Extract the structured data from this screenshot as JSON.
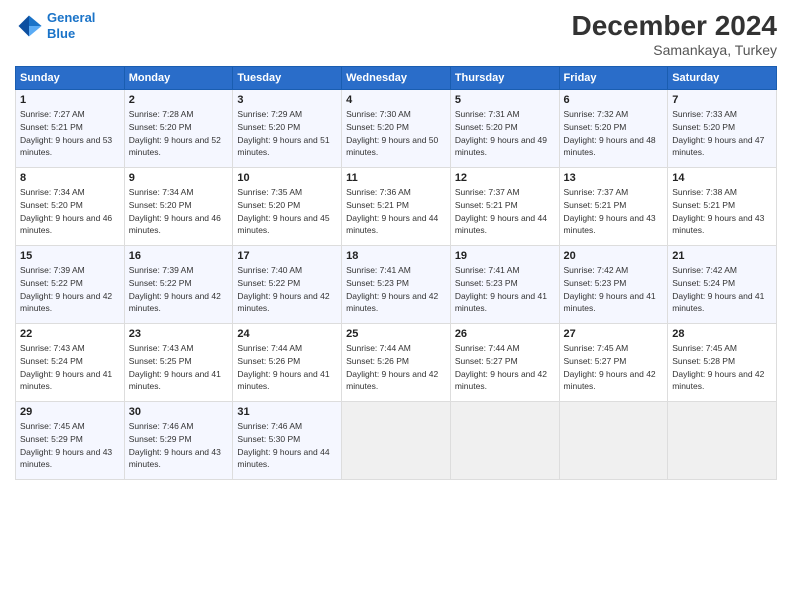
{
  "logo": {
    "line1": "General",
    "line2": "Blue"
  },
  "title": "December 2024",
  "subtitle": "Samankaya, Turkey",
  "days_of_week": [
    "Sunday",
    "Monday",
    "Tuesday",
    "Wednesday",
    "Thursday",
    "Friday",
    "Saturday"
  ],
  "weeks": [
    [
      {
        "day": "1",
        "sunrise": "Sunrise: 7:27 AM",
        "sunset": "Sunset: 5:21 PM",
        "daylight": "Daylight: 9 hours and 53 minutes."
      },
      {
        "day": "2",
        "sunrise": "Sunrise: 7:28 AM",
        "sunset": "Sunset: 5:20 PM",
        "daylight": "Daylight: 9 hours and 52 minutes."
      },
      {
        "day": "3",
        "sunrise": "Sunrise: 7:29 AM",
        "sunset": "Sunset: 5:20 PM",
        "daylight": "Daylight: 9 hours and 51 minutes."
      },
      {
        "day": "4",
        "sunrise": "Sunrise: 7:30 AM",
        "sunset": "Sunset: 5:20 PM",
        "daylight": "Daylight: 9 hours and 50 minutes."
      },
      {
        "day": "5",
        "sunrise": "Sunrise: 7:31 AM",
        "sunset": "Sunset: 5:20 PM",
        "daylight": "Daylight: 9 hours and 49 minutes."
      },
      {
        "day": "6",
        "sunrise": "Sunrise: 7:32 AM",
        "sunset": "Sunset: 5:20 PM",
        "daylight": "Daylight: 9 hours and 48 minutes."
      },
      {
        "day": "7",
        "sunrise": "Sunrise: 7:33 AM",
        "sunset": "Sunset: 5:20 PM",
        "daylight": "Daylight: 9 hours and 47 minutes."
      }
    ],
    [
      {
        "day": "8",
        "sunrise": "Sunrise: 7:34 AM",
        "sunset": "Sunset: 5:20 PM",
        "daylight": "Daylight: 9 hours and 46 minutes."
      },
      {
        "day": "9",
        "sunrise": "Sunrise: 7:34 AM",
        "sunset": "Sunset: 5:20 PM",
        "daylight": "Daylight: 9 hours and 46 minutes."
      },
      {
        "day": "10",
        "sunrise": "Sunrise: 7:35 AM",
        "sunset": "Sunset: 5:20 PM",
        "daylight": "Daylight: 9 hours and 45 minutes."
      },
      {
        "day": "11",
        "sunrise": "Sunrise: 7:36 AM",
        "sunset": "Sunset: 5:21 PM",
        "daylight": "Daylight: 9 hours and 44 minutes."
      },
      {
        "day": "12",
        "sunrise": "Sunrise: 7:37 AM",
        "sunset": "Sunset: 5:21 PM",
        "daylight": "Daylight: 9 hours and 44 minutes."
      },
      {
        "day": "13",
        "sunrise": "Sunrise: 7:37 AM",
        "sunset": "Sunset: 5:21 PM",
        "daylight": "Daylight: 9 hours and 43 minutes."
      },
      {
        "day": "14",
        "sunrise": "Sunrise: 7:38 AM",
        "sunset": "Sunset: 5:21 PM",
        "daylight": "Daylight: 9 hours and 43 minutes."
      }
    ],
    [
      {
        "day": "15",
        "sunrise": "Sunrise: 7:39 AM",
        "sunset": "Sunset: 5:22 PM",
        "daylight": "Daylight: 9 hours and 42 minutes."
      },
      {
        "day": "16",
        "sunrise": "Sunrise: 7:39 AM",
        "sunset": "Sunset: 5:22 PM",
        "daylight": "Daylight: 9 hours and 42 minutes."
      },
      {
        "day": "17",
        "sunrise": "Sunrise: 7:40 AM",
        "sunset": "Sunset: 5:22 PM",
        "daylight": "Daylight: 9 hours and 42 minutes."
      },
      {
        "day": "18",
        "sunrise": "Sunrise: 7:41 AM",
        "sunset": "Sunset: 5:23 PM",
        "daylight": "Daylight: 9 hours and 42 minutes."
      },
      {
        "day": "19",
        "sunrise": "Sunrise: 7:41 AM",
        "sunset": "Sunset: 5:23 PM",
        "daylight": "Daylight: 9 hours and 41 minutes."
      },
      {
        "day": "20",
        "sunrise": "Sunrise: 7:42 AM",
        "sunset": "Sunset: 5:23 PM",
        "daylight": "Daylight: 9 hours and 41 minutes."
      },
      {
        "day": "21",
        "sunrise": "Sunrise: 7:42 AM",
        "sunset": "Sunset: 5:24 PM",
        "daylight": "Daylight: 9 hours and 41 minutes."
      }
    ],
    [
      {
        "day": "22",
        "sunrise": "Sunrise: 7:43 AM",
        "sunset": "Sunset: 5:24 PM",
        "daylight": "Daylight: 9 hours and 41 minutes."
      },
      {
        "day": "23",
        "sunrise": "Sunrise: 7:43 AM",
        "sunset": "Sunset: 5:25 PM",
        "daylight": "Daylight: 9 hours and 41 minutes."
      },
      {
        "day": "24",
        "sunrise": "Sunrise: 7:44 AM",
        "sunset": "Sunset: 5:26 PM",
        "daylight": "Daylight: 9 hours and 41 minutes."
      },
      {
        "day": "25",
        "sunrise": "Sunrise: 7:44 AM",
        "sunset": "Sunset: 5:26 PM",
        "daylight": "Daylight: 9 hours and 42 minutes."
      },
      {
        "day": "26",
        "sunrise": "Sunrise: 7:44 AM",
        "sunset": "Sunset: 5:27 PM",
        "daylight": "Daylight: 9 hours and 42 minutes."
      },
      {
        "day": "27",
        "sunrise": "Sunrise: 7:45 AM",
        "sunset": "Sunset: 5:27 PM",
        "daylight": "Daylight: 9 hours and 42 minutes."
      },
      {
        "day": "28",
        "sunrise": "Sunrise: 7:45 AM",
        "sunset": "Sunset: 5:28 PM",
        "daylight": "Daylight: 9 hours and 42 minutes."
      }
    ],
    [
      {
        "day": "29",
        "sunrise": "Sunrise: 7:45 AM",
        "sunset": "Sunset: 5:29 PM",
        "daylight": "Daylight: 9 hours and 43 minutes."
      },
      {
        "day": "30",
        "sunrise": "Sunrise: 7:46 AM",
        "sunset": "Sunset: 5:29 PM",
        "daylight": "Daylight: 9 hours and 43 minutes."
      },
      {
        "day": "31",
        "sunrise": "Sunrise: 7:46 AM",
        "sunset": "Sunset: 5:30 PM",
        "daylight": "Daylight: 9 hours and 44 minutes."
      },
      null,
      null,
      null,
      null
    ]
  ]
}
